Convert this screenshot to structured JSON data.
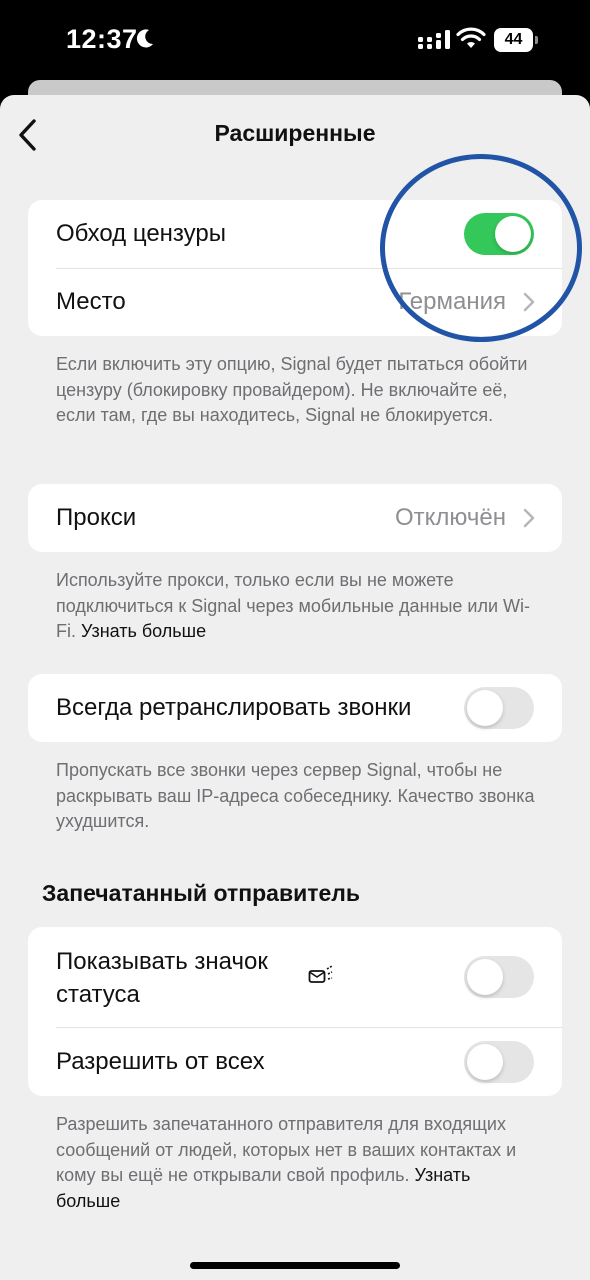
{
  "status_bar": {
    "time": "12:37",
    "battery": "44",
    "icons": [
      "moon-icon",
      "cellular-signal-icon",
      "wifi-icon",
      "battery-icon"
    ]
  },
  "nav": {
    "title": "Расширенные",
    "back_icon": "chevron-left-icon"
  },
  "censorship": {
    "toggle_label": "Обход цензуры",
    "toggle_on": true,
    "location_label": "Место",
    "location_value": "Германия",
    "note": "Если включить эту опцию, Signal будет пытаться обойти цензуру (блокировку провайдером). Не включайте её, если там, где вы находитесь, Signal не блокируется."
  },
  "proxy": {
    "label": "Прокси",
    "value": "Отключён",
    "note": "Используйте прокси, только если вы не можете подключиться к Signal через мобильные данные или Wi-Fi.",
    "learn_more": "Узнать больше"
  },
  "relay_calls": {
    "label": "Всегда ретранслировать звонки",
    "toggle_on": false,
    "note": "Пропускать все звонки через сервер Signal, чтобы не раскрывать ваш IP-адреса собеседнику. Качество звонка ухудшится."
  },
  "sealed_sender": {
    "header": "Запечатанный отправитель",
    "show_status_label": "Показывать значок статуса",
    "show_status_icon": "sealed-sender-icon",
    "show_status_on": false,
    "allow_all_label": "Разрешить от всех",
    "allow_all_on": false,
    "note": "Разрешить запечатанного отправителя для входящих сообщений от людей, которых нет в ваших контактах и кому вы ещё не открывали свой профиль.",
    "learn_more": "Узнать больше"
  },
  "colors": {
    "toggle_on": "#34c759",
    "toggle_off": "#e5e5e5",
    "annotation_circle": "#2154a6",
    "background": "#efefef"
  }
}
